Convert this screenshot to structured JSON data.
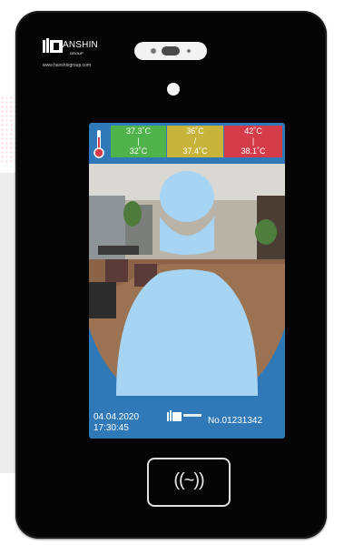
{
  "brand": {
    "name": "ANSHIN",
    "sub": "GROUP",
    "url": "www.hanshingroup.com"
  },
  "thresholds": [
    {
      "top": "37.3˚C",
      "mid": "|",
      "bottom": "32˚C",
      "color": "#4fb24a"
    },
    {
      "top": "36˚C",
      "mid": "/",
      "bottom": "37.4˚C",
      "color": "#c8b43a"
    },
    {
      "top": "42˚C",
      "mid": "|",
      "bottom": "38.1˚C",
      "color": "#d53c4a"
    }
  ],
  "footer": {
    "date": "04.04.2020",
    "time": "17:30:45",
    "serial": "No.01231342"
  },
  "nfc": {
    "symbol": "((~))"
  },
  "icons": [
    "thermometer-icon",
    "brand-logo-icon",
    "nfc-icon",
    "camera-icon",
    "person-silhouette-icon"
  ]
}
